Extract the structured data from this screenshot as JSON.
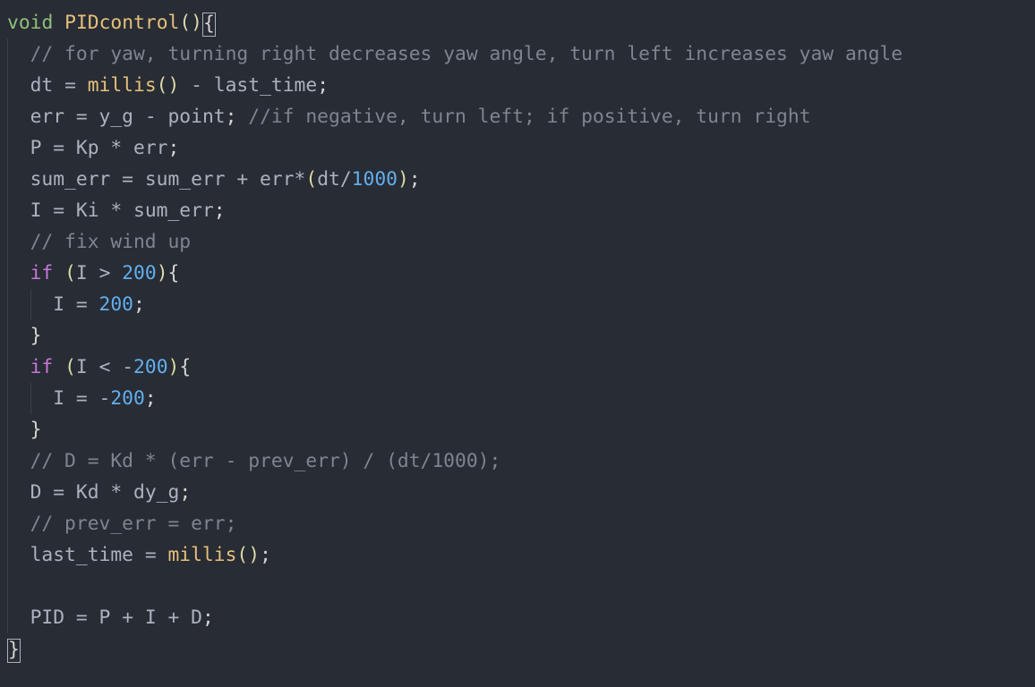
{
  "code": {
    "lines": [
      [
        {
          "cls": "tok-type",
          "t": "void"
        },
        {
          "cls": "",
          "t": " "
        },
        {
          "cls": "tok-fn",
          "t": "PIDcontrol"
        },
        {
          "cls": "tok-par",
          "t": "()"
        },
        {
          "cls": "cursor-box tok-pun",
          "t": "{"
        }
      ],
      [
        {
          "cls": "tok-cmt",
          "t": "// for yaw, turning right decreases yaw angle, turn left increases yaw angle"
        }
      ],
      [
        {
          "cls": "tok-id",
          "t": "dt "
        },
        {
          "cls": "tok-op",
          "t": "="
        },
        {
          "cls": "",
          "t": " "
        },
        {
          "cls": "tok-call",
          "t": "millis"
        },
        {
          "cls": "tok-par",
          "t": "()"
        },
        {
          "cls": "",
          "t": " "
        },
        {
          "cls": "tok-op",
          "t": "-"
        },
        {
          "cls": "",
          "t": " last_time"
        },
        {
          "cls": "tok-pun",
          "t": ";"
        }
      ],
      [
        {
          "cls": "tok-id",
          "t": "err "
        },
        {
          "cls": "tok-op",
          "t": "="
        },
        {
          "cls": "",
          "t": " y_g "
        },
        {
          "cls": "tok-op",
          "t": "-"
        },
        {
          "cls": "",
          "t": " point"
        },
        {
          "cls": "tok-pun",
          "t": ";"
        },
        {
          "cls": "",
          "t": " "
        },
        {
          "cls": "tok-cmt",
          "t": "//if negative, turn left; if positive, turn right"
        }
      ],
      [
        {
          "cls": "tok-id",
          "t": "P "
        },
        {
          "cls": "tok-op",
          "t": "="
        },
        {
          "cls": "",
          "t": " Kp "
        },
        {
          "cls": "tok-op",
          "t": "*"
        },
        {
          "cls": "",
          "t": " err"
        },
        {
          "cls": "tok-pun",
          "t": ";"
        }
      ],
      [
        {
          "cls": "tok-id",
          "t": "sum_err "
        },
        {
          "cls": "tok-op",
          "t": "="
        },
        {
          "cls": "",
          "t": " sum_err "
        },
        {
          "cls": "tok-op",
          "t": "+"
        },
        {
          "cls": "",
          "t": " err"
        },
        {
          "cls": "tok-op",
          "t": "*"
        },
        {
          "cls": "tok-par",
          "t": "("
        },
        {
          "cls": "",
          "t": "dt"
        },
        {
          "cls": "tok-op",
          "t": "/"
        },
        {
          "cls": "tok-num",
          "t": "1000"
        },
        {
          "cls": "tok-par",
          "t": ")"
        },
        {
          "cls": "tok-pun",
          "t": ";"
        }
      ],
      [
        {
          "cls": "tok-id",
          "t": "I "
        },
        {
          "cls": "tok-op",
          "t": "="
        },
        {
          "cls": "",
          "t": " Ki "
        },
        {
          "cls": "tok-op",
          "t": "*"
        },
        {
          "cls": "",
          "t": " sum_err"
        },
        {
          "cls": "tok-pun",
          "t": ";"
        }
      ],
      [
        {
          "cls": "tok-cmt",
          "t": "// fix wind up"
        }
      ],
      [
        {
          "cls": "tok-kw",
          "t": "if"
        },
        {
          "cls": "",
          "t": " "
        },
        {
          "cls": "tok-par",
          "t": "("
        },
        {
          "cls": "",
          "t": "I "
        },
        {
          "cls": "tok-op",
          "t": ">"
        },
        {
          "cls": "",
          "t": " "
        },
        {
          "cls": "tok-num",
          "t": "200"
        },
        {
          "cls": "tok-par",
          "t": ")"
        },
        {
          "cls": "tok-pun",
          "t": "{"
        }
      ],
      [
        {
          "cls": "tok-id",
          "t": "I "
        },
        {
          "cls": "tok-op",
          "t": "="
        },
        {
          "cls": "",
          "t": " "
        },
        {
          "cls": "tok-num",
          "t": "200"
        },
        {
          "cls": "tok-pun",
          "t": ";"
        }
      ],
      [
        {
          "cls": "tok-pun",
          "t": "}"
        }
      ],
      [
        {
          "cls": "tok-kw",
          "t": "if"
        },
        {
          "cls": "",
          "t": " "
        },
        {
          "cls": "tok-par",
          "t": "("
        },
        {
          "cls": "",
          "t": "I "
        },
        {
          "cls": "tok-op",
          "t": "<"
        },
        {
          "cls": "",
          "t": " "
        },
        {
          "cls": "tok-op",
          "t": "-"
        },
        {
          "cls": "tok-num",
          "t": "200"
        },
        {
          "cls": "tok-par",
          "t": ")"
        },
        {
          "cls": "tok-pun",
          "t": "{"
        }
      ],
      [
        {
          "cls": "tok-id",
          "t": "I "
        },
        {
          "cls": "tok-op",
          "t": "="
        },
        {
          "cls": "",
          "t": " "
        },
        {
          "cls": "tok-op",
          "t": "-"
        },
        {
          "cls": "tok-num",
          "t": "200"
        },
        {
          "cls": "tok-pun",
          "t": ";"
        }
      ],
      [
        {
          "cls": "tok-pun",
          "t": "}"
        }
      ],
      [
        {
          "cls": "tok-cmt",
          "t": "// D = Kd * (err - prev_err) / (dt/1000);"
        }
      ],
      [
        {
          "cls": "tok-id",
          "t": "D "
        },
        {
          "cls": "tok-op",
          "t": "="
        },
        {
          "cls": "",
          "t": " Kd "
        },
        {
          "cls": "tok-op",
          "t": "*"
        },
        {
          "cls": "",
          "t": " dy_g"
        },
        {
          "cls": "tok-pun",
          "t": ";"
        }
      ],
      [
        {
          "cls": "tok-cmt",
          "t": "// prev_err = err;"
        }
      ],
      [
        {
          "cls": "tok-id",
          "t": "last_time "
        },
        {
          "cls": "tok-op",
          "t": "="
        },
        {
          "cls": "",
          "t": " "
        },
        {
          "cls": "tok-call",
          "t": "millis"
        },
        {
          "cls": "tok-par",
          "t": "()"
        },
        {
          "cls": "tok-pun",
          "t": ";"
        }
      ],
      [],
      [
        {
          "cls": "tok-id",
          "t": "PID "
        },
        {
          "cls": "tok-op",
          "t": "="
        },
        {
          "cls": "",
          "t": " P "
        },
        {
          "cls": "tok-op",
          "t": "+"
        },
        {
          "cls": "",
          "t": " I "
        },
        {
          "cls": "tok-op",
          "t": "+"
        },
        {
          "cls": "",
          "t": " D"
        },
        {
          "cls": "tok-pun",
          "t": ";"
        }
      ]
    ],
    "indent": [
      0,
      1,
      1,
      1,
      1,
      1,
      1,
      1,
      1,
      2,
      1,
      1,
      2,
      1,
      1,
      1,
      1,
      1,
      1,
      1
    ],
    "closing": "}"
  }
}
